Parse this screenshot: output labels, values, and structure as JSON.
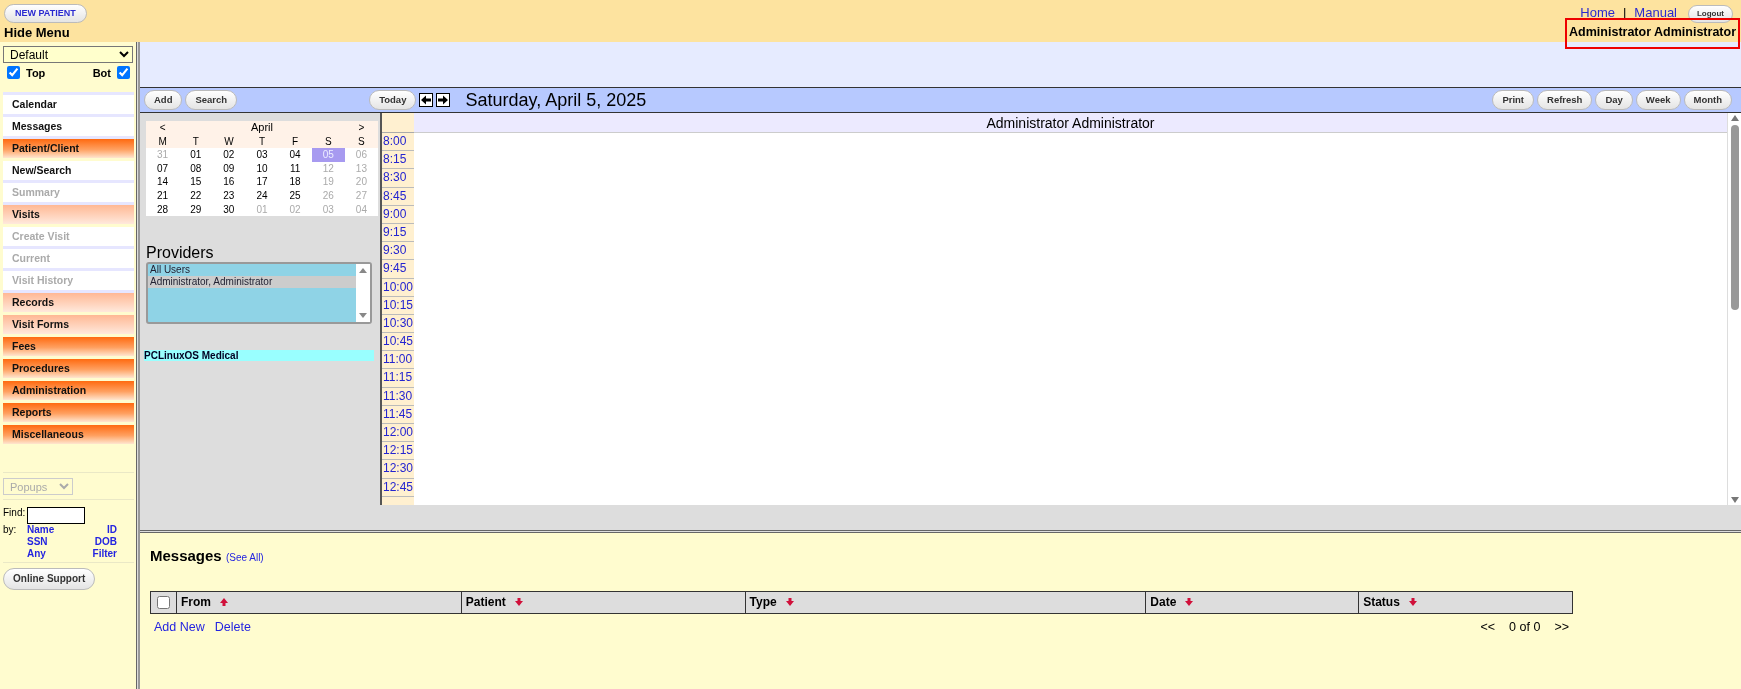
{
  "header": {
    "new_patient": "NEW PATIENT",
    "hide_menu": "Hide Menu",
    "links": [
      "Home",
      "Manual"
    ],
    "separator": "|",
    "logout": "Logout",
    "user": "Administrator Administrator",
    "user_highlighted": true
  },
  "sidebar": {
    "layout_select": "Default",
    "checkboxes": [
      {
        "label": "Top",
        "checked": true
      },
      {
        "label": "Bot",
        "checked": true
      }
    ],
    "menu": [
      {
        "label": "Calendar",
        "kind": "link",
        "disabled": false
      },
      {
        "label": "Messages",
        "kind": "link",
        "disabled": false
      },
      {
        "label": "Patient/Client",
        "kind": "group",
        "disabled": false
      },
      {
        "label": "New/Search",
        "kind": "link",
        "disabled": false
      },
      {
        "label": "Summary",
        "kind": "link",
        "disabled": true
      },
      {
        "label": "Visits",
        "kind": "subgroup",
        "disabled": false
      },
      {
        "label": "Create Visit",
        "kind": "link",
        "disabled": true
      },
      {
        "label": "Current",
        "kind": "link",
        "disabled": true
      },
      {
        "label": "Visit History",
        "kind": "link",
        "disabled": true
      },
      {
        "label": "Records",
        "kind": "subgroup",
        "disabled": false
      },
      {
        "label": "Visit Forms",
        "kind": "subgroup",
        "disabled": false
      },
      {
        "label": "Fees",
        "kind": "group",
        "disabled": false
      },
      {
        "label": "Procedures",
        "kind": "group",
        "disabled": false
      },
      {
        "label": "Administration",
        "kind": "group",
        "disabled": false
      },
      {
        "label": "Reports",
        "kind": "group",
        "disabled": false
      },
      {
        "label": "Miscellaneous",
        "kind": "group",
        "disabled": false
      }
    ],
    "popups": {
      "label": "Popups",
      "disabled": true
    },
    "find_label": "Find:",
    "by_label": "by:",
    "by_links": [
      "Name",
      "ID",
      "SSN",
      "DOB",
      "Any",
      "Filter"
    ],
    "online_support": "Online Support"
  },
  "toolbar": {
    "left_buttons": [
      "Add",
      "Search"
    ],
    "today": "Today",
    "date": "Saturday, April 5, 2025",
    "right_buttons": [
      "Print",
      "Refresh",
      "Day",
      "Week",
      "Month"
    ]
  },
  "mini_calendar": {
    "prev": "<",
    "month": "April",
    "next": ">",
    "weekdays": [
      "M",
      "T",
      "W",
      "T",
      "F",
      "S",
      "S"
    ],
    "weeks": [
      [
        {
          "day": "31",
          "dimmed": true,
          "selected": false
        },
        {
          "day": "01",
          "dimmed": false,
          "selected": false
        },
        {
          "day": "02",
          "dimmed": false,
          "selected": false
        },
        {
          "day": "03",
          "dimmed": false,
          "selected": false
        },
        {
          "day": "04",
          "dimmed": false,
          "selected": false
        },
        {
          "day": "05",
          "dimmed": true,
          "selected": true
        },
        {
          "day": "06",
          "dimmed": true,
          "selected": false
        }
      ],
      [
        {
          "day": "07",
          "dimmed": false,
          "selected": false
        },
        {
          "day": "08",
          "dimmed": false,
          "selected": false
        },
        {
          "day": "09",
          "dimmed": false,
          "selected": false
        },
        {
          "day": "10",
          "dimmed": false,
          "selected": false
        },
        {
          "day": "11",
          "dimmed": false,
          "selected": false
        },
        {
          "day": "12",
          "dimmed": true,
          "selected": false
        },
        {
          "day": "13",
          "dimmed": true,
          "selected": false
        }
      ],
      [
        {
          "day": "14",
          "dimmed": false,
          "selected": false
        },
        {
          "day": "15",
          "dimmed": false,
          "selected": false
        },
        {
          "day": "16",
          "dimmed": false,
          "selected": false
        },
        {
          "day": "17",
          "dimmed": false,
          "selected": false
        },
        {
          "day": "18",
          "dimmed": false,
          "selected": false
        },
        {
          "day": "19",
          "dimmed": true,
          "selected": false
        },
        {
          "day": "20",
          "dimmed": true,
          "selected": false
        }
      ],
      [
        {
          "day": "21",
          "dimmed": false,
          "selected": false
        },
        {
          "day": "22",
          "dimmed": false,
          "selected": false
        },
        {
          "day": "23",
          "dimmed": false,
          "selected": false
        },
        {
          "day": "24",
          "dimmed": false,
          "selected": false
        },
        {
          "day": "25",
          "dimmed": false,
          "selected": false
        },
        {
          "day": "26",
          "dimmed": true,
          "selected": false
        },
        {
          "day": "27",
          "dimmed": true,
          "selected": false
        }
      ],
      [
        {
          "day": "28",
          "dimmed": false,
          "selected": false
        },
        {
          "day": "29",
          "dimmed": false,
          "selected": false
        },
        {
          "day": "30",
          "dimmed": false,
          "selected": false
        },
        {
          "day": "01",
          "dimmed": true,
          "selected": false
        },
        {
          "day": "02",
          "dimmed": true,
          "selected": false
        },
        {
          "day": "03",
          "dimmed": true,
          "selected": false
        },
        {
          "day": "04",
          "dimmed": true,
          "selected": false
        }
      ]
    ]
  },
  "providers": {
    "title": "Providers",
    "items": [
      {
        "label": "All Users",
        "selected": false
      },
      {
        "label": "Administrator, Administrator",
        "selected": true
      }
    ]
  },
  "facility": "PCLinuxOS Medical",
  "schedule": {
    "column": "Administrator Administrator",
    "times": [
      "8:00",
      "8:15",
      "8:30",
      "8:45",
      "9:00",
      "9:15",
      "9:30",
      "9:45",
      "10:00",
      "10:15",
      "10:30",
      "10:45",
      "11:00",
      "11:15",
      "11:30",
      "11:45",
      "12:00",
      "12:15",
      "12:30",
      "12:45"
    ]
  },
  "messages": {
    "title": "Messages",
    "see_all": "(See All)",
    "select_all_checked": false,
    "columns": [
      {
        "label": "From",
        "sort_ascending": true
      },
      {
        "label": "Patient",
        "sort_ascending": false
      },
      {
        "label": "Type",
        "sort_ascending": false
      },
      {
        "label": "Date",
        "sort_ascending": false
      },
      {
        "label": "Status",
        "sort_ascending": false
      }
    ],
    "actions": [
      "Add New",
      "Delete"
    ],
    "pager": {
      "first": "<<",
      "count": "0 of 0",
      "last": ">>"
    }
  }
}
